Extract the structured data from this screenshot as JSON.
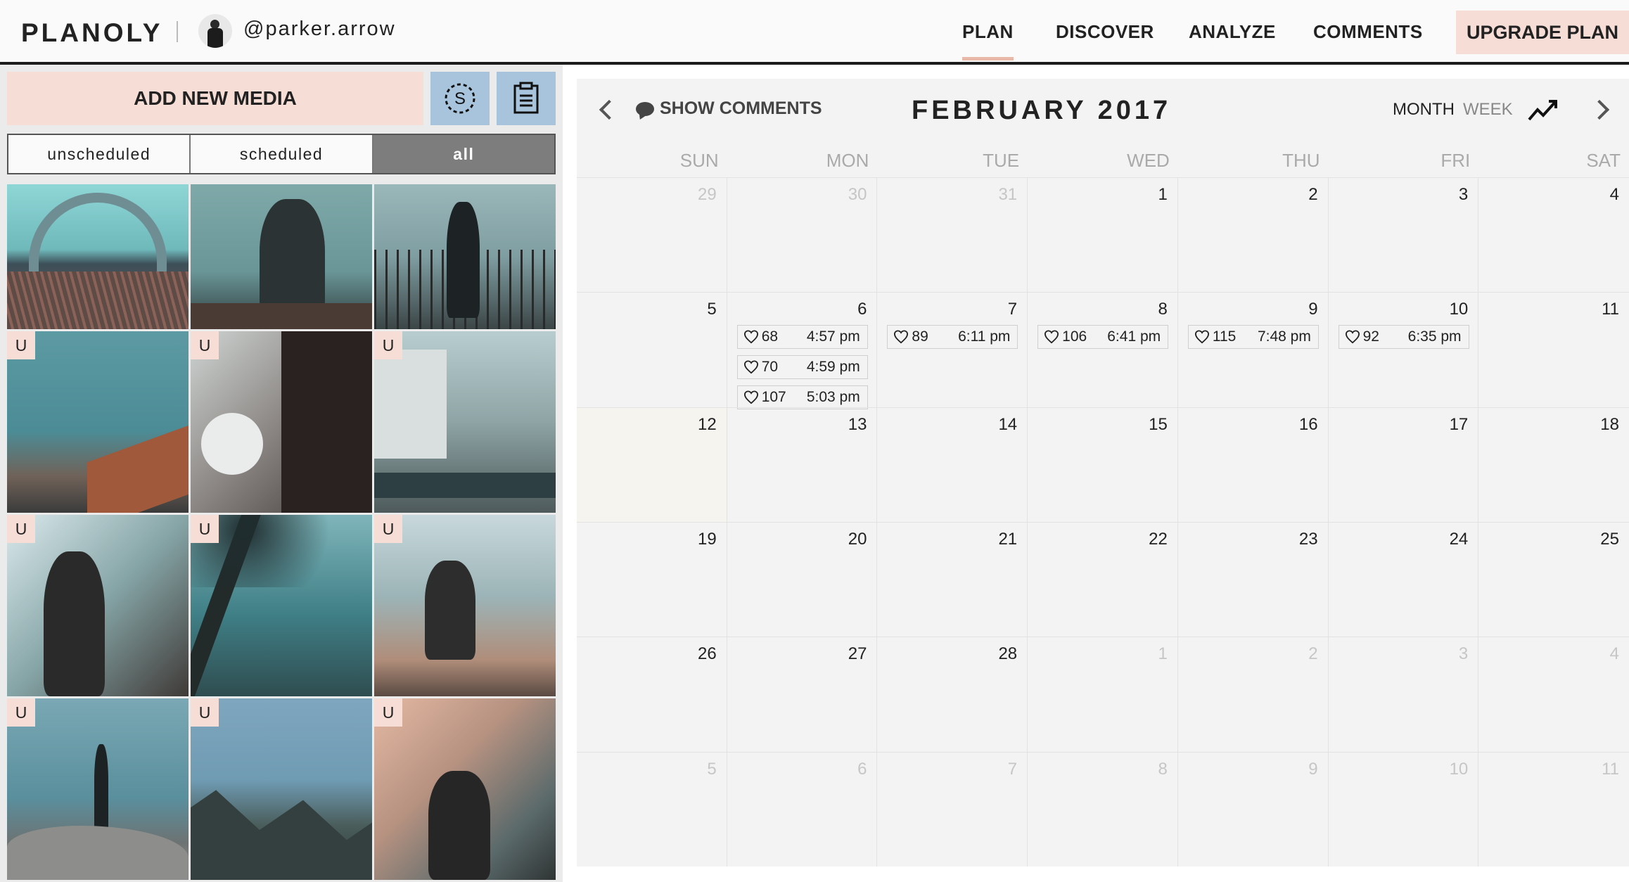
{
  "header": {
    "logo": "PLANOLY",
    "username": "@parker.arrow",
    "nav": [
      "PLAN",
      "DISCOVER",
      "ANALYZE",
      "COMMENTS"
    ],
    "active_nav": "PLAN",
    "upgrade_label": "UPGRADE PLAN"
  },
  "sidebar": {
    "add_media_label": "ADD NEW MEDIA",
    "s_button_label": "S",
    "filters": [
      "unscheduled",
      "scheduled",
      "all"
    ],
    "active_filter": "all",
    "badge_label": "U",
    "tiles": [
      {
        "badge": false
      },
      {
        "badge": false
      },
      {
        "badge": false
      },
      {
        "badge": true
      },
      {
        "badge": true
      },
      {
        "badge": true
      },
      {
        "badge": true
      },
      {
        "badge": true
      },
      {
        "badge": true
      },
      {
        "badge": true
      },
      {
        "badge": true
      },
      {
        "badge": true
      }
    ]
  },
  "calendar": {
    "show_comments_label": "SHOW COMMENTS",
    "title": "FEBRUARY 2017",
    "view_month": "MONTH",
    "view_week": "WEEK",
    "active_view": "MONTH",
    "weekdays": [
      "SUN",
      "MON",
      "TUE",
      "WED",
      "THU",
      "FRI",
      "SAT"
    ],
    "days": [
      {
        "n": "29",
        "muted": true
      },
      {
        "n": "30",
        "muted": true
      },
      {
        "n": "31",
        "muted": true
      },
      {
        "n": "1"
      },
      {
        "n": "2"
      },
      {
        "n": "3"
      },
      {
        "n": "4"
      },
      {
        "n": "5"
      },
      {
        "n": "6",
        "posts": [
          {
            "likes": "68",
            "time": "4:57 pm"
          },
          {
            "likes": "70",
            "time": "4:59 pm"
          },
          {
            "likes": "107",
            "time": "5:03 pm"
          }
        ]
      },
      {
        "n": "7",
        "posts": [
          {
            "likes": "89",
            "time": "6:11 pm"
          }
        ]
      },
      {
        "n": "8",
        "posts": [
          {
            "likes": "106",
            "time": "6:41 pm"
          }
        ]
      },
      {
        "n": "9",
        "posts": [
          {
            "likes": "115",
            "time": "7:48 pm"
          }
        ]
      },
      {
        "n": "10",
        "posts": [
          {
            "likes": "92",
            "time": "6:35 pm"
          }
        ]
      },
      {
        "n": "11"
      },
      {
        "n": "12",
        "today": true
      },
      {
        "n": "13"
      },
      {
        "n": "14"
      },
      {
        "n": "15"
      },
      {
        "n": "16"
      },
      {
        "n": "17"
      },
      {
        "n": "18"
      },
      {
        "n": "19"
      },
      {
        "n": "20"
      },
      {
        "n": "21"
      },
      {
        "n": "22"
      },
      {
        "n": "23"
      },
      {
        "n": "24"
      },
      {
        "n": "25"
      },
      {
        "n": "26"
      },
      {
        "n": "27"
      },
      {
        "n": "28"
      },
      {
        "n": "1",
        "muted": true
      },
      {
        "n": "2",
        "muted": true
      },
      {
        "n": "3",
        "muted": true
      },
      {
        "n": "4",
        "muted": true
      },
      {
        "n": "5",
        "muted": true
      },
      {
        "n": "6",
        "muted": true
      },
      {
        "n": "7",
        "muted": true
      },
      {
        "n": "8",
        "muted": true
      },
      {
        "n": "9",
        "muted": true
      },
      {
        "n": "10",
        "muted": true
      },
      {
        "n": "11",
        "muted": true
      }
    ]
  },
  "colors": {
    "accent_pink": "#f6ddd5",
    "accent_blue": "#a8c4dc",
    "active_filter_bg": "#7d7d7d",
    "header_rule": "#1c1c1c"
  }
}
